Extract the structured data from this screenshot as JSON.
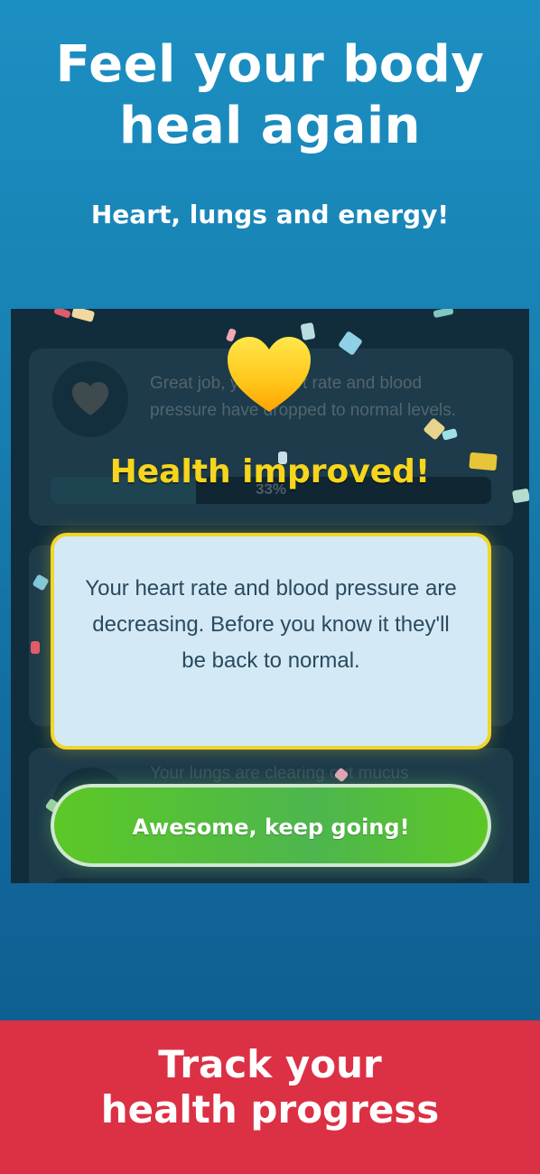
{
  "headline": {
    "line1": "Feel your body",
    "line2": "heal again"
  },
  "subheadline": "Heart, lungs and energy!",
  "app_screen": {
    "background_card": {
      "message": "Great job, your heart rate and blood pressure have dropped to normal levels.",
      "progress_label": "33%",
      "progress_fraction": 0.33
    },
    "background_card_2": {
      "message_partial": "Your lungs are clearing out mucus"
    },
    "popup": {
      "emoji": "yellow-heart-icon",
      "title": "Health improved!",
      "message": "Your heart rate and blood pressure are decreasing. Before you know it they'll be back to normal.",
      "button_label": "Awesome, keep going!"
    }
  },
  "footer": {
    "line1": "Track your",
    "line2": "health progress"
  },
  "colors": {
    "background_top": "#1c8fc2",
    "background_bottom": "#0d5a8c",
    "footer": "#dc3045",
    "title_yellow": "#f7d51d",
    "button_green": "#5cc826",
    "dialog_bg": "#d4e9f6"
  }
}
